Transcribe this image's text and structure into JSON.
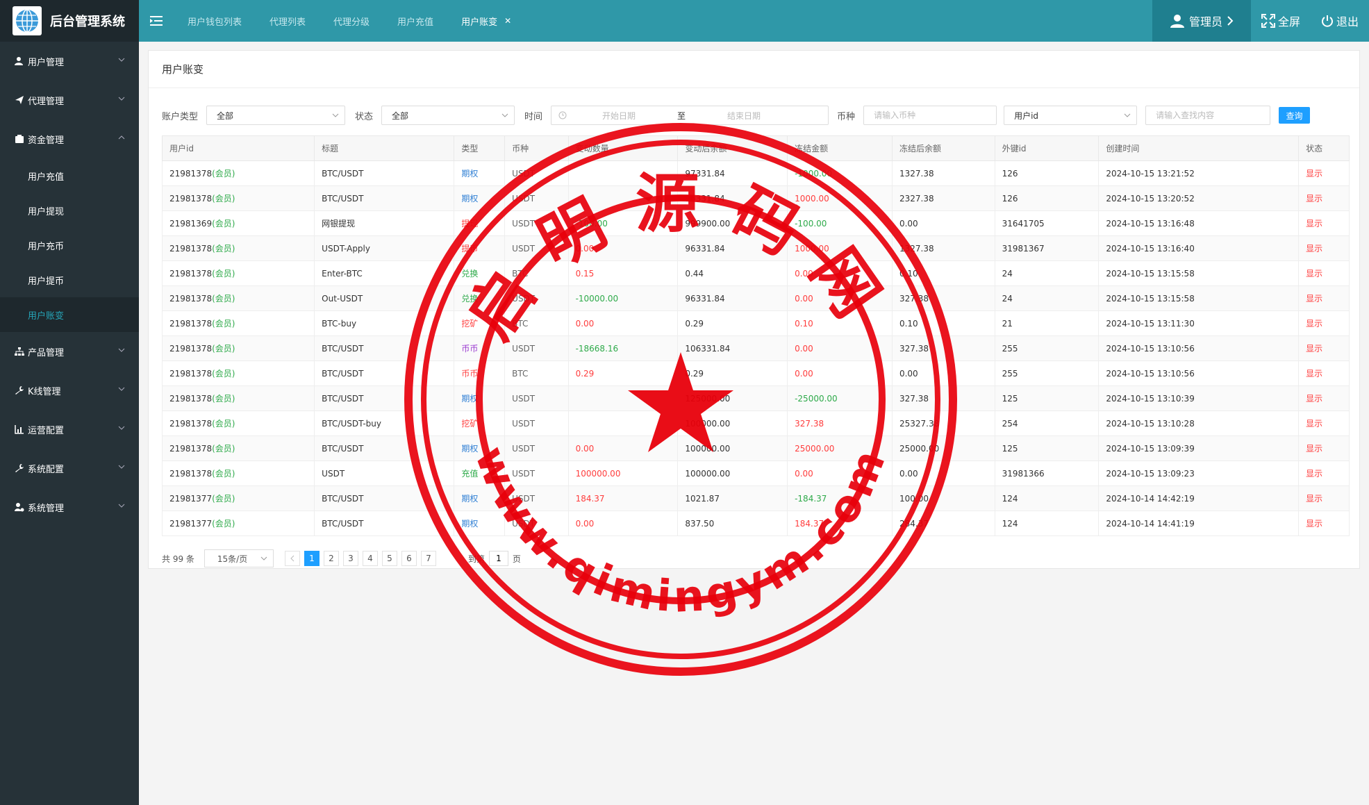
{
  "app": {
    "title": "后台管理系统"
  },
  "sidebar": {
    "items": [
      {
        "label": "用户管理",
        "icon": "user-icon",
        "expanded": false
      },
      {
        "label": "代理管理",
        "icon": "send-icon",
        "expanded": false
      },
      {
        "label": "资金管理",
        "icon": "wallet-icon",
        "expanded": true,
        "children": [
          "用户充值",
          "用户提现",
          "用户充币",
          "用户提币",
          "用户账变"
        ],
        "active_child": "用户账变"
      },
      {
        "label": "产品管理",
        "icon": "sitemap-icon",
        "expanded": false
      },
      {
        "label": "K线管理",
        "icon": "wrench-icon",
        "expanded": false
      },
      {
        "label": "运营配置",
        "icon": "chart-icon",
        "expanded": false
      },
      {
        "label": "系统配置",
        "icon": "wrench-icon",
        "expanded": false
      },
      {
        "label": "系统管理",
        "icon": "user-gear-icon",
        "expanded": false
      }
    ]
  },
  "header": {
    "tabs": [
      "用户钱包列表",
      "代理列表",
      "代理分级",
      "用户充值",
      "用户账变"
    ],
    "active_tab": "用户账变",
    "admin_label": "管理员",
    "fullscreen_label": "全屏",
    "logout_label": "退出"
  },
  "panel": {
    "title": "用户账变"
  },
  "filters": {
    "account_type_label": "账户类型",
    "account_type_value": "全部",
    "status_label": "状态",
    "status_value": "全部",
    "time_label": "时间",
    "start_placeholder": "开始日期",
    "date_sep": "至",
    "end_placeholder": "结束日期",
    "currency_label": "币种",
    "currency_placeholder": "请输入币种",
    "field_select_value": "用户id",
    "search_placeholder": "请输入查找内容",
    "search_button": "查询"
  },
  "table": {
    "headers": [
      "用户id",
      "标题",
      "类型",
      "币种",
      "变动数量",
      "变动后余额",
      "冻结金额",
      "冻结后余额",
      "外键id",
      "创建时间",
      "状态"
    ],
    "rows": [
      [
        "21981378",
        "(会员)",
        "BTC/USDT",
        "期权",
        "USDT",
        "",
        "97331.84",
        "-1000.00",
        "1327.38",
        "126",
        "2024-10-15 13:21:52",
        "显示"
      ],
      [
        "21981378",
        "(会员)",
        "BTC/USDT",
        "期权",
        "USDT",
        "",
        "96331.84",
        "1000.00",
        "2327.38",
        "126",
        "2024-10-15 13:20:52",
        "显示"
      ],
      [
        "21981369",
        "(会员)",
        "网银提现",
        "提现",
        "USDT",
        "-100.00",
        "999900.00",
        "-100.00",
        "0.00",
        "31641705",
        "2024-10-15 13:16:48",
        "显示"
      ],
      [
        "21981378",
        "(会员)",
        "USDT-Apply",
        "提币",
        "USDT",
        "0.00",
        "96331.84",
        "1000.00",
        "1327.38",
        "31981367",
        "2024-10-15 13:16:40",
        "显示"
      ],
      [
        "21981378",
        "(会员)",
        "Enter-BTC",
        "兑换",
        "BTC",
        "0.15",
        "0.44",
        "0.00",
        "0.10",
        "24",
        "2024-10-15 13:15:58",
        "显示"
      ],
      [
        "21981378",
        "(会员)",
        "Out-USDT",
        "兑换",
        "USDT",
        "-10000.00",
        "96331.84",
        "0.00",
        "327.38",
        "24",
        "2024-10-15 13:15:58",
        "显示"
      ],
      [
        "21981378",
        "(会员)",
        "BTC-buy",
        "挖矿",
        "BTC",
        "0.00",
        "0.29",
        "0.10",
        "0.10",
        "21",
        "2024-10-15 13:11:30",
        "显示"
      ],
      [
        "21981378",
        "(会员)",
        "BTC/USDT",
        "币币",
        "USDT",
        "-18668.16",
        "106331.84",
        "0.00",
        "327.38",
        "255",
        "2024-10-15 13:10:56",
        "显示"
      ],
      [
        "21981378",
        "(会员)",
        "BTC/USDT",
        "币币",
        "BTC",
        "0.29",
        "0.29",
        "0.00",
        "0.00",
        "255",
        "2024-10-15 13:10:56",
        "显示"
      ],
      [
        "21981378",
        "(会员)",
        "BTC/USDT",
        "期权",
        "USDT",
        "",
        "125000.00",
        "-25000.00",
        "327.38",
        "125",
        "2024-10-15 13:10:39",
        "显示"
      ],
      [
        "21981378",
        "(会员)",
        "BTC/USDT-buy",
        "挖矿",
        "USDT",
        "",
        "100000.00",
        "327.38",
        "25327.38",
        "254",
        "2024-10-15 13:10:28",
        "显示"
      ],
      [
        "21981378",
        "(会员)",
        "BTC/USDT",
        "期权",
        "USDT",
        "0.00",
        "100000.00",
        "25000.00",
        "25000.00",
        "125",
        "2024-10-15 13:09:39",
        "显示"
      ],
      [
        "21981378",
        "(会员)",
        "USDT",
        "充值",
        "USDT",
        "100000.00",
        "100000.00",
        "0.00",
        "0.00",
        "31981366",
        "2024-10-15 13:09:23",
        "显示"
      ],
      [
        "21981377",
        "(会员)",
        "BTC/USDT",
        "期权",
        "USDT",
        "184.37",
        "1021.87",
        "-184.37",
        "100.00",
        "124",
        "2024-10-14 14:42:19",
        "显示"
      ],
      [
        "21981377",
        "(会员)",
        "BTC/USDT",
        "期权",
        "USDT",
        "0.00",
        "837.50",
        "184.37",
        "284.37",
        "124",
        "2024-10-14 14:41:19",
        "显示"
      ]
    ],
    "change_colors": [
      "",
      "",
      "green",
      "red",
      "red",
      "green",
      "red",
      "green",
      "red",
      "",
      "",
      "red",
      "red",
      "red",
      "red"
    ],
    "frozen_colors": [
      "green",
      "red",
      "green",
      "red",
      "red",
      "red",
      "red",
      "red",
      "red",
      "green",
      "red",
      "red",
      "red",
      "green",
      "red"
    ],
    "type_colors": [
      "blue",
      "blue",
      "red",
      "red",
      "green",
      "green",
      "red",
      "purple",
      "red",
      "blue",
      "red",
      "blue",
      "green",
      "blue",
      "blue"
    ]
  },
  "pagination": {
    "total_label": "共 99 条",
    "page_size": "15条/页",
    "pages": [
      "1",
      "2",
      "3",
      "4",
      "5",
      "6",
      "7"
    ],
    "current_page": "1",
    "goto_prefix": "到第",
    "goto_value": "1",
    "goto_suffix": "页"
  },
  "watermark": {
    "center_text": "启明源码网",
    "url_text": "www.qimingym.com",
    "color": "#e8000b"
  }
}
